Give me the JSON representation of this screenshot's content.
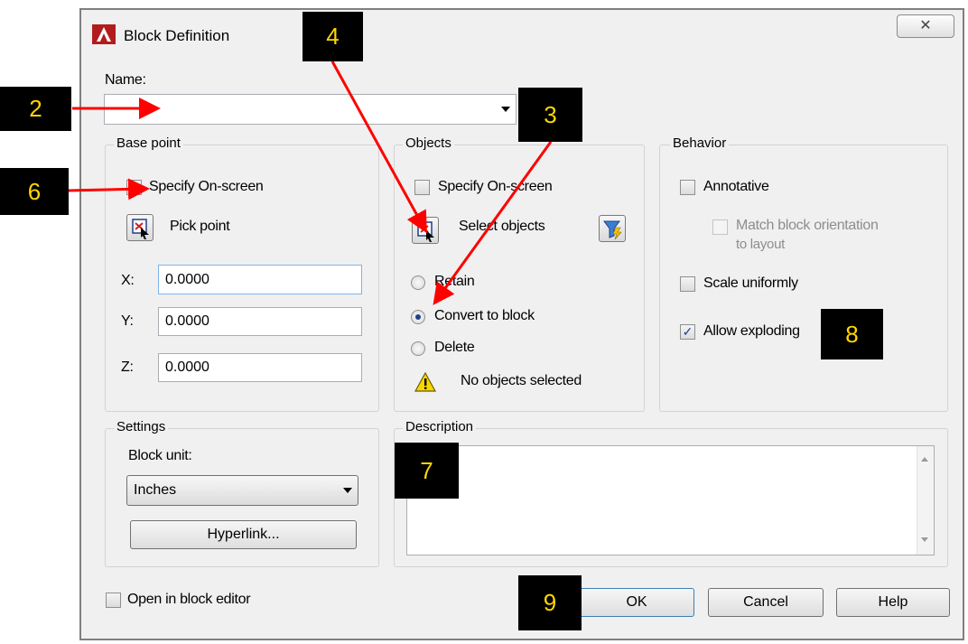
{
  "window": {
    "title": "Block Definition",
    "close_glyph": "✕"
  },
  "name": {
    "label": "Name:",
    "value": ""
  },
  "base_point": {
    "legend": "Base point",
    "specify_label": "Specify On-screen",
    "pick_point_label": "Pick point",
    "x_label": "X:",
    "x_value": "0.0000",
    "y_label": "Y:",
    "y_value": "0.0000",
    "z_label": "Z:",
    "z_value": "0.0000"
  },
  "objects": {
    "legend": "Objects",
    "specify_label": "Specify On-screen",
    "select_label": "Select objects",
    "retain_label": "Retain",
    "convert_label": "Convert to block",
    "delete_label": "Delete",
    "status": "No objects selected",
    "selected_option": "Convert to block"
  },
  "behavior": {
    "legend": "Behavior",
    "annotative_label": "Annotative",
    "match_line1": "Match block orientation",
    "match_line2": "to layout",
    "scale_label": "Scale uniformly",
    "explode_label": "Allow exploding",
    "explode_checked": true
  },
  "settings": {
    "legend": "Settings",
    "unit_label": "Block unit:",
    "unit_value": "Inches",
    "hyperlink_label": "Hyperlink..."
  },
  "description": {
    "legend": "Description",
    "value": ""
  },
  "footer": {
    "open_editor_label": "Open in block editor",
    "ok_label": "OK",
    "cancel_label": "Cancel",
    "help_label": "Help"
  },
  "callouts": [
    "2",
    "3",
    "4",
    "6",
    "7",
    "8",
    "9"
  ],
  "colors": {
    "callout_bg": "#000000",
    "callout_text": "#ffd700",
    "arrow": "#ff0000"
  }
}
